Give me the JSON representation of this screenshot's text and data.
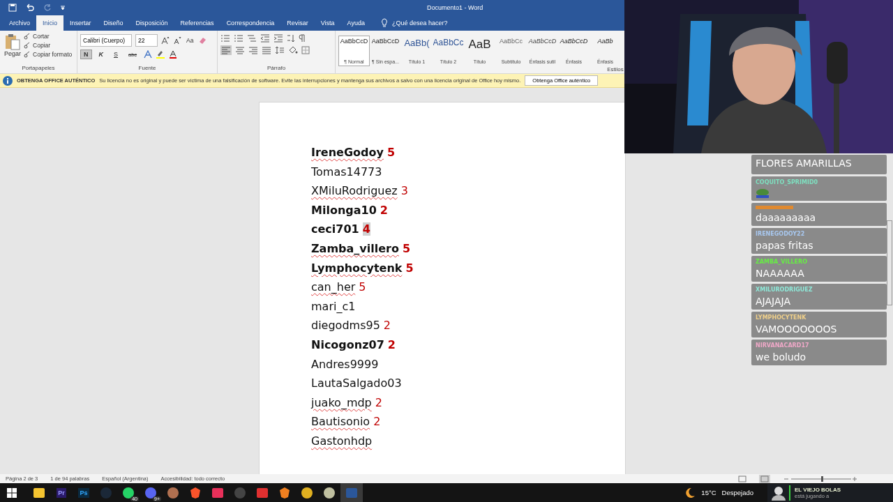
{
  "window": {
    "title": "Documento1  -  Word"
  },
  "tabs": [
    {
      "label": "Archivo",
      "selected": false
    },
    {
      "label": "Inicio",
      "selected": true
    },
    {
      "label": "Insertar",
      "selected": false
    },
    {
      "label": "Diseño",
      "selected": false
    },
    {
      "label": "Disposición",
      "selected": false
    },
    {
      "label": "Referencias",
      "selected": false
    },
    {
      "label": "Correspondencia",
      "selected": false
    },
    {
      "label": "Revisar",
      "selected": false
    },
    {
      "label": "Vista",
      "selected": false
    },
    {
      "label": "Ayuda",
      "selected": false
    }
  ],
  "tell_me": "¿Qué desea hacer?",
  "clipboard": {
    "paste": "Pegar",
    "items": [
      "Cortar",
      "Copiar",
      "Copiar formato"
    ],
    "group": "Portapapeles"
  },
  "font": {
    "family": "Calibri (Cuerpo)",
    "size": "22",
    "case": "Aa",
    "buttons": [
      {
        "label": "N",
        "selected": true
      },
      {
        "label": "K",
        "selected": false
      },
      {
        "label": "S",
        "selected": false
      },
      {
        "label": "abc",
        "selected": false
      }
    ],
    "group": "Fuente"
  },
  "paragraph": {
    "group": "Párrafo"
  },
  "styles": {
    "group": "Estilos",
    "items": [
      {
        "sample": "AaBbCcD",
        "name": "¶ Normal",
        "kind": "normal",
        "selected": true
      },
      {
        "sample": "AaBbCcD",
        "name": "¶ Sin espa...",
        "kind": "normal",
        "selected": false
      },
      {
        "sample": "AaBb(",
        "name": "Título 1",
        "kind": "heading1",
        "selected": false
      },
      {
        "sample": "AaBbCc",
        "name": "Título 2",
        "kind": "heading2",
        "selected": false
      },
      {
        "sample": "AaB",
        "name": "Título",
        "kind": "title",
        "selected": false
      },
      {
        "sample": "AaBbCc",
        "name": "Subtítulo",
        "kind": "subtitle",
        "selected": false
      },
      {
        "sample": "AaBbCcD",
        "name": "Énfasis sutil",
        "kind": "subtle",
        "selected": false
      },
      {
        "sample": "AaBbCcD",
        "name": "Énfasis",
        "kind": "emphasis",
        "selected": false
      },
      {
        "sample": "AaBb",
        "name": "Énfasis",
        "kind": "emphasis",
        "selected": false
      }
    ]
  },
  "notice": {
    "title": "OBTENGA OFFICE AUTÉNTICO",
    "message": "Su licencia no es original y puede ser víctima de una falsificación de software. Evite las interrupciones y mantenga sus archivos a salvo con una licencia original de Office hoy mismo.",
    "button": "Obtenga Office auténtico"
  },
  "document": {
    "lines": [
      {
        "name": "IreneGodoy",
        "score": "5",
        "bold": true,
        "misspelled": true,
        "highlighted": false
      },
      {
        "name": "Tomas14773",
        "bold": false,
        "misspelled": false
      },
      {
        "name": "XMiluRodriguez",
        "score": "3",
        "bold": false,
        "misspelled": true,
        "highlighted": false
      },
      {
        "name": "Milonga10",
        "score": "2",
        "bold": true,
        "misspelled": false,
        "highlighted": false
      },
      {
        "name": "ceci701",
        "score": "4",
        "bold": true,
        "misspelled": false,
        "highlighted": true
      },
      {
        "name": "Zamba_villero",
        "score": "5",
        "bold": true,
        "misspelled": true,
        "highlighted": false
      },
      {
        "name": "Lymphocytenk",
        "score": "5",
        "bold": true,
        "misspelled": true,
        "highlighted": false
      },
      {
        "name": "can_her",
        "score": "5",
        "bold": false,
        "misspelled": true,
        "highlighted": false
      },
      {
        "name": "mari_c1",
        "bold": false,
        "misspelled": false
      },
      {
        "name": "diegodms95",
        "score": "2",
        "bold": false,
        "misspelled": false,
        "highlighted": false
      },
      {
        "name": "Nicogonz07",
        "score": "2",
        "bold": true,
        "misspelled": false,
        "highlighted": false
      },
      {
        "name": "Andres9999",
        "bold": false,
        "misspelled": false
      },
      {
        "name": "LautaSalgado03",
        "bold": false,
        "misspelled": false
      },
      {
        "name": "juako_mdp",
        "score": "2",
        "bold": false,
        "misspelled": true,
        "highlighted": false
      },
      {
        "name": "Bautisonio",
        "score": "2",
        "bold": false,
        "misspelled": true,
        "highlighted": false
      },
      {
        "name": "Gastonhdp",
        "bold": false,
        "misspelled": true
      }
    ]
  },
  "status_bar": [
    "Página 2 de 3",
    "1 de 94 palabras",
    "Español (Argentina)",
    "Accesibilidad: todo correcto"
  ],
  "chat": [
    {
      "kind": "text",
      "text": "FLORES AMARILLAS"
    },
    {
      "kind": "emote",
      "user": "COQUITO_SPRIMID0",
      "color": "#7ee0c0"
    },
    {
      "kind": "text",
      "text": "daaaaaaaaa",
      "color": "#e08a30"
    },
    {
      "kind": "text",
      "user": "IRENEGODOY22",
      "color": "#a8c8f0",
      "text": "papas fritas"
    },
    {
      "kind": "text",
      "user": "ZAMBA_VILLERO",
      "color": "#66ee44",
      "text": "NAAAAAA"
    },
    {
      "kind": "text",
      "user": "XMILURODRIGUEZ",
      "color": "#8ee8d8",
      "text": "AJAJAJA"
    },
    {
      "kind": "text",
      "user": "LYMPHOCYTENK",
      "color": "#f0d08a",
      "text": "VAMOOOOOOOS"
    },
    {
      "kind": "text",
      "user": "NIRVANACARD17",
      "color": "#f0a8c8",
      "text": "we boludo"
    }
  ],
  "taskbar": {
    "apps": [
      {
        "kind": "folder",
        "active": false
      },
      {
        "kind": "premiere",
        "label": "Pr",
        "active": false
      },
      {
        "kind": "photoshop",
        "label": "Ps",
        "active": false
      },
      {
        "kind": "steam",
        "active": false
      },
      {
        "kind": "whatsapp",
        "badge": "40",
        "active": false
      },
      {
        "kind": "discord",
        "badge": "9+",
        "active": false
      },
      {
        "kind": "round",
        "active": false
      },
      {
        "kind": "brave",
        "active": false
      },
      {
        "kind": "tiktok",
        "active": false
      },
      {
        "kind": "obs",
        "active": false
      },
      {
        "kind": "redapp",
        "active": false
      },
      {
        "kind": "fruit",
        "active": false
      },
      {
        "kind": "chrome",
        "active": false
      },
      {
        "kind": "paint",
        "active": false
      },
      {
        "kind": "word",
        "active": true
      }
    ],
    "weather": {
      "temp": "15°C",
      "condition": "Despejado"
    },
    "notification": {
      "title": "EL VIEJO BOLAS",
      "subtitle": "está jugando a"
    }
  }
}
